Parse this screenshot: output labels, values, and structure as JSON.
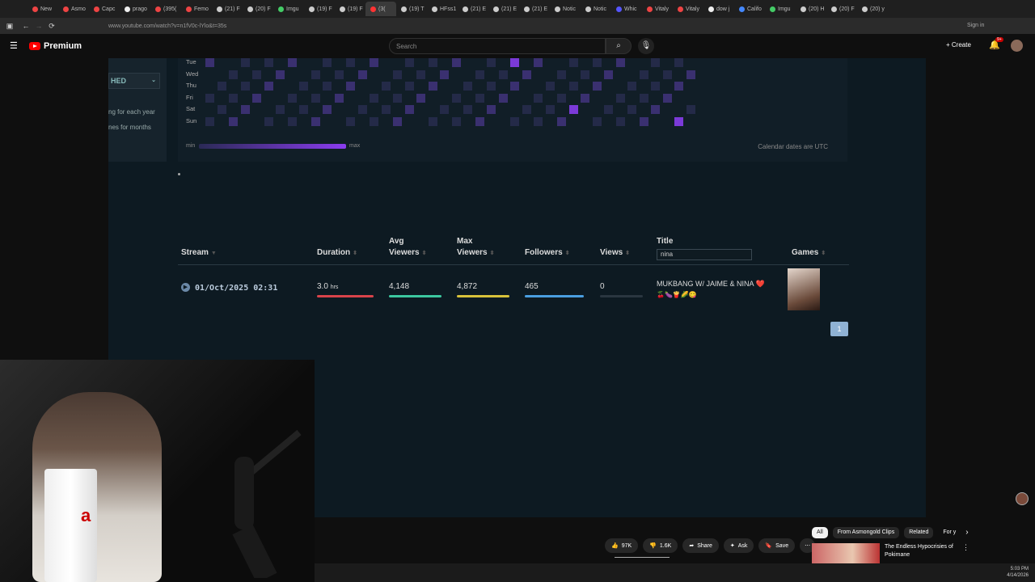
{
  "browser": {
    "tabs": [
      {
        "label": "New",
        "color": "#e44"
      },
      {
        "label": "Asmo",
        "color": "#e44"
      },
      {
        "label": "Capc",
        "color": "#e44"
      },
      {
        "label": "prago",
        "color": "#eee"
      },
      {
        "label": "(395(",
        "color": "#e44"
      },
      {
        "label": "Femo",
        "color": "#e44"
      },
      {
        "label": "(21) F",
        "color": "#ccc"
      },
      {
        "label": "(20) F",
        "color": "#ccc"
      },
      {
        "label": "Imgu",
        "color": "#4c6"
      },
      {
        "label": "(19) F",
        "color": "#ccc"
      },
      {
        "label": "(19) F",
        "color": "#ccc"
      },
      {
        "label": "(3(",
        "color": "#f33",
        "active": true
      },
      {
        "label": "(19) T",
        "color": "#ccc"
      },
      {
        "label": "HFss1",
        "color": "#ccc"
      },
      {
        "label": "(21) E",
        "color": "#ccc"
      },
      {
        "label": "(21) E",
        "color": "#ccc"
      },
      {
        "label": "(21) E",
        "color": "#ccc"
      },
      {
        "label": "Notic",
        "color": "#ccc"
      },
      {
        "label": "Notic",
        "color": "#ccc"
      },
      {
        "label": "Whic",
        "color": "#55f"
      },
      {
        "label": "Vitaly",
        "color": "#e44"
      },
      {
        "label": "Vitaly",
        "color": "#e44"
      },
      {
        "label": "dow j",
        "color": "#eee"
      },
      {
        "label": "Califo",
        "color": "#48f"
      },
      {
        "label": "Imgu",
        "color": "#4c6"
      },
      {
        "label": "(20) H",
        "color": "#ccc"
      },
      {
        "label": "(20) F",
        "color": "#ccc"
      },
      {
        "label": "(20) y",
        "color": "#ccc"
      }
    ],
    "url": "www.youtube.com/watch?v=n1fV0c-lYlo&t=35s",
    "signin": "Sign in"
  },
  "youtube": {
    "brand": "Premium",
    "search_placeholder": "Search",
    "create_label": "Create",
    "notif_count": "9+"
  },
  "heatmap": {
    "days": [
      "Tue",
      "Wed",
      "Thu",
      "Fri",
      "Sat",
      "Sun"
    ],
    "legend_min": "min",
    "legend_max": "max",
    "utc_note": "Calendar dates are UTC",
    "filter_label": "HED",
    "side_text_1": "ng for each year",
    "side_text_2": "nes for months"
  },
  "table": {
    "headers": {
      "stream": "Stream",
      "duration": "Duration",
      "avg_viewers_1": "Avg",
      "avg_viewers_2": "Viewers",
      "max_viewers_1": "Max",
      "max_viewers_2": "Viewers",
      "followers": "Followers",
      "views": "Views",
      "title": "Title",
      "games": "Games"
    },
    "title_filter": "nina",
    "row": {
      "date": "01/Oct/2025 02:31",
      "duration": "3.0",
      "duration_unit": "hrs",
      "avg_viewers": "4,148",
      "max_viewers": "4,872",
      "followers": "465",
      "views": "0",
      "title_line1": "MUKBANG W/ JAIME & NINA ❤️",
      "title_line2": "🍒🍆🍟🌽😋"
    },
    "page": "1"
  },
  "video_actions": {
    "likes": "97K",
    "dislikes": "1.6K",
    "share": "Share",
    "ask": "Ask",
    "save": "Save"
  },
  "chips": [
    "All",
    "From Asmongold Clips",
    "Related",
    "For y"
  ],
  "recommendation": {
    "title_line1": "The Endless Hypocrisies of",
    "title_line2": "Pokimane"
  },
  "clock": {
    "time": "5:03 PM",
    "date": "4/14/2026"
  }
}
